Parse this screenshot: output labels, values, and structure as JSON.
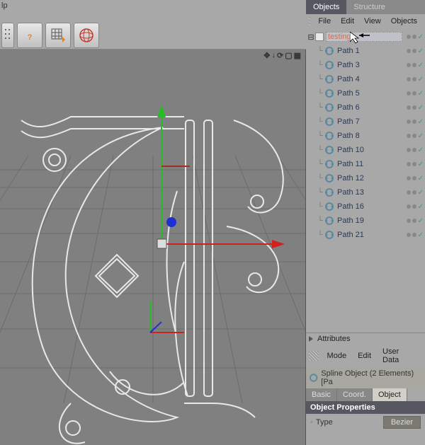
{
  "help_label": "lp",
  "panel": {
    "tabs": [
      "Objects",
      "Structure"
    ],
    "active_tab": "Objects",
    "menu": [
      "File",
      "Edit",
      "View",
      "Objects"
    ]
  },
  "tree": {
    "root": {
      "label": "testing",
      "selected": true
    },
    "children": [
      {
        "label": "Path 1"
      },
      {
        "label": "Path 3"
      },
      {
        "label": "Path 4"
      },
      {
        "label": "Path 5"
      },
      {
        "label": "Path 6"
      },
      {
        "label": "Path 7"
      },
      {
        "label": "Path 8"
      },
      {
        "label": "Path 10"
      },
      {
        "label": "Path 11"
      },
      {
        "label": "Path 12"
      },
      {
        "label": "Path 13"
      },
      {
        "label": "Path 16"
      },
      {
        "label": "Path 19"
      },
      {
        "label": "Path 21"
      }
    ]
  },
  "attributes": {
    "header": "Attributes",
    "menu": [
      "Mode",
      "Edit",
      "User Data"
    ],
    "summary": "Spline Object (2 Elements) [Pa",
    "tabs": [
      "Basic",
      "Coord.",
      "Object"
    ],
    "active_tab": "Object",
    "section": "Object Properties",
    "prop_label": "Type",
    "prop_value": "Bezier"
  },
  "view_icons": [
    "✥",
    "↓",
    "⟳",
    "▢",
    "▦"
  ]
}
